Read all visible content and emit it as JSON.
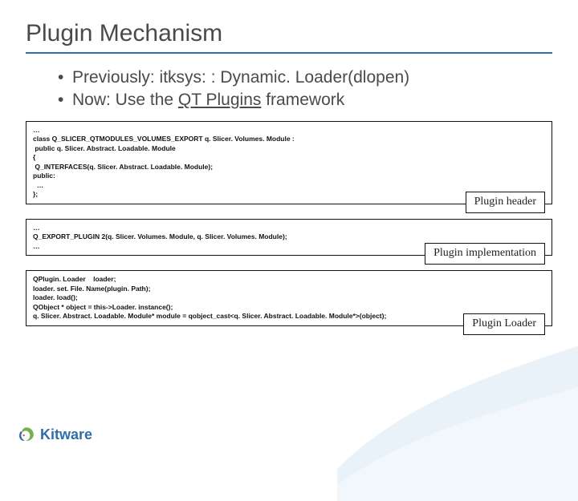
{
  "title": "Plugin Mechanism",
  "bullets": [
    {
      "prefix": "Previously: ",
      "rest": "itksys: : Dynamic. Loader(dlopen)"
    },
    {
      "prefix": "Now: Use the ",
      "link": "QT Plugins",
      "suffix": " framework"
    }
  ],
  "boxes": [
    {
      "label": "Plugin header",
      "lines": [
        "…",
        "class Q_SLICER_QTMODULES_VOLUMES_EXPORT q. Slicer. Volumes. Module :",
        " public q. Slicer. Abstract. Loadable. Module",
        "{",
        " Q_INTERFACES(q. Slicer. Abstract. Loadable. Module);",
        "public:",
        "  …",
        "};"
      ]
    },
    {
      "label": "Plugin implementation",
      "lines": [
        "…",
        "Q_EXPORT_PLUGIN 2(q. Slicer. Volumes. Module, q. Slicer. Volumes. Module);",
        "…"
      ]
    },
    {
      "label": "Plugin Loader",
      "lines": [
        "QPlugin. Loader    loader;",
        "loader. set. File. Name(plugin. Path);",
        "loader. load();",
        "QObject * object = this->Loader. instance();",
        "q. Slicer. Abstract. Loadable. Module* module = qobject_cast<q. Slicer. Abstract. Loadable. Module*>(object);"
      ]
    }
  ],
  "footer_brand": "Kitware"
}
